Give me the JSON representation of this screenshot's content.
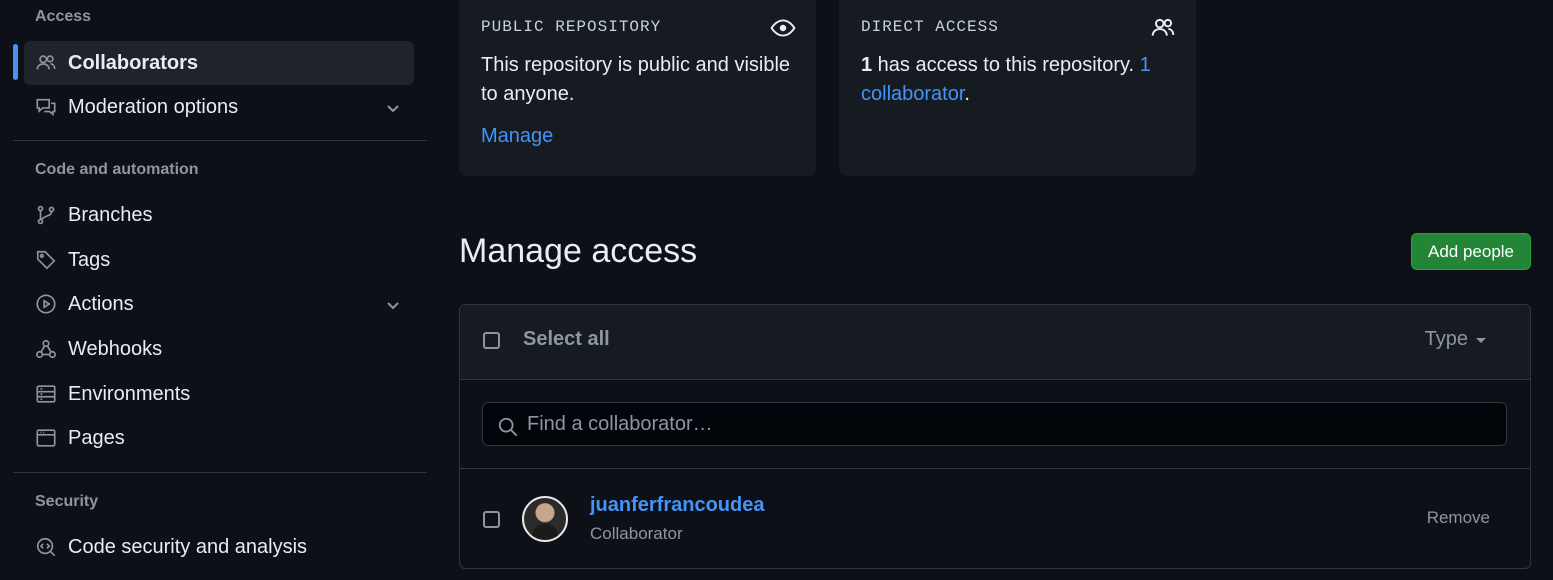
{
  "sidebar": {
    "sections": {
      "access": "Access",
      "code_automation": "Code and automation",
      "security": "Security"
    },
    "items": [
      {
        "label": "Collaborators",
        "icon": "people-icon",
        "active": true
      },
      {
        "label": "Moderation options",
        "icon": "comment-discussion-icon",
        "expandable": true
      },
      {
        "label": "Branches",
        "icon": "git-branch-icon"
      },
      {
        "label": "Tags",
        "icon": "tag-icon"
      },
      {
        "label": "Actions",
        "icon": "play-icon",
        "expandable": true
      },
      {
        "label": "Webhooks",
        "icon": "webhook-icon"
      },
      {
        "label": "Environments",
        "icon": "server-icon"
      },
      {
        "label": "Pages",
        "icon": "browser-icon"
      },
      {
        "label": "Code security and analysis",
        "icon": "codescan-icon"
      }
    ]
  },
  "cards": {
    "public": {
      "kicker": "PUBLIC REPOSITORY",
      "text": "This repository is public and visible to anyone.",
      "action": "Manage",
      "icon": "eye-icon"
    },
    "direct": {
      "kicker": "DIRECT ACCESS",
      "count": "1",
      "text": " has access to this repository. ",
      "link": "1 collaborator",
      "suffix": ".",
      "icon": "people-icon"
    }
  },
  "manage": {
    "title": "Manage access",
    "add_button": "Add people",
    "select_all": "Select all",
    "type_filter": "Type",
    "search_placeholder": "Find a collaborator…",
    "collaborators": [
      {
        "username": "juanferfrancoudea",
        "role": "Collaborator",
        "action": "Remove"
      }
    ]
  },
  "colors": {
    "background": "#0d1117",
    "card": "#161b22",
    "accent": "#4493f8",
    "primary_button": "#238636",
    "muted": "#8d96a0"
  }
}
